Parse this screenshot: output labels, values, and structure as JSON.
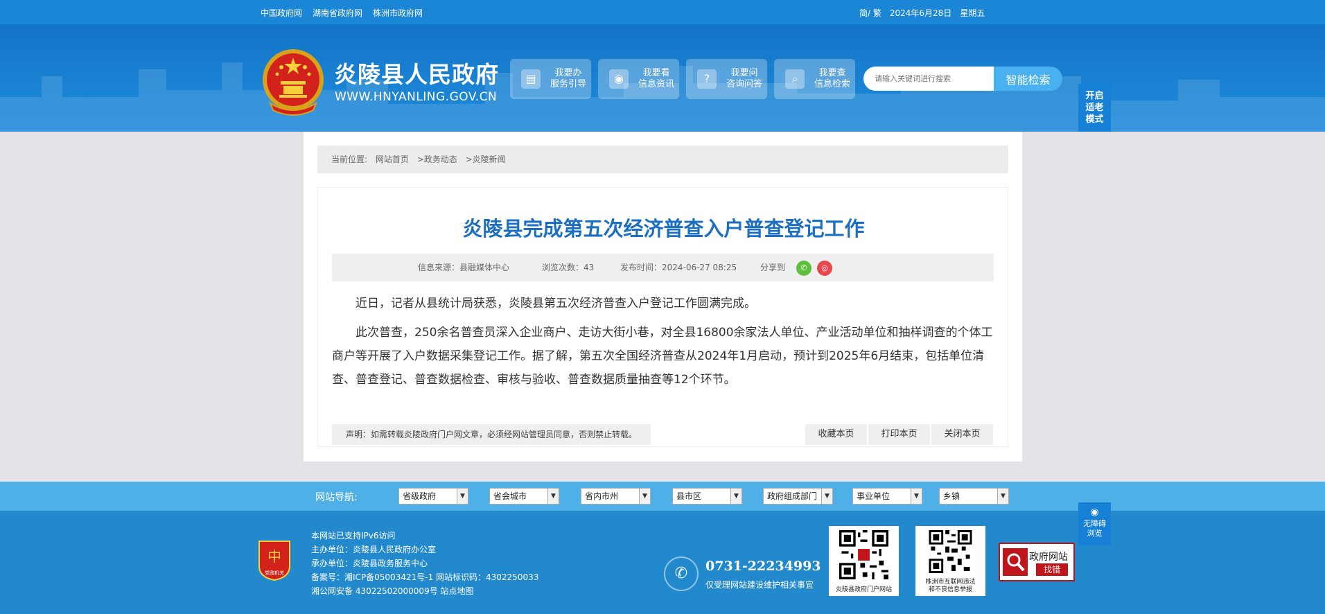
{
  "topbar": {
    "links": [
      "中国政府网",
      "湖南省政府网",
      "株洲市政府网"
    ],
    "lang": "简/ 繁",
    "date": "2024年6月28日",
    "weekday": "星期五"
  },
  "header": {
    "site_name": "炎陵县人民政府",
    "site_url": "WWW.HNYANLING.GOV.CN",
    "buttons": [
      {
        "line1": "我要办",
        "line2": "服务引导",
        "icon": "document-icon"
      },
      {
        "line1": "我要看",
        "line2": "信息资讯",
        "icon": "eye-icon"
      },
      {
        "line1": "我要问",
        "line2": "咨询问答",
        "icon": "question-icon"
      },
      {
        "line1": "我要查",
        "line2": "信息检索",
        "icon": "search-icon"
      }
    ],
    "search_placeholder": "请输入关键词进行搜索",
    "search_button": "智能检索",
    "elder_mode": "开启适老模式"
  },
  "breadcrumb": {
    "label": "当前位置:",
    "items": [
      "网站首页",
      ">政务动态",
      ">炎陵新闻"
    ]
  },
  "article": {
    "title": "炎陵县完成第五次经济普查入户普查登记工作",
    "source": "信息来源：县融媒体中心",
    "views": "浏览次数：43",
    "published": "发布时间：2024-06-27 08:25",
    "share_label": "分享到",
    "paragraphs": [
      "近日，记者从县统计局获悉，炎陵县第五次经济普查入户登记工作圆满完成。",
      "此次普查，250余名普查员深入企业商户、走访大街小巷，对全县16800余家法人单位、产业活动单位和抽样调查的个体工商户等开展了入户数据采集登记工作。据了解，第五次全国经济普查从2024年1月启动，预计到2025年6月结束，包括单位清查、普查登记、普查数据检查、审核与验收、普查数据质量抽查等12个环节。"
    ],
    "notice": "声明：如需转载炎陵政府门户网文章，必须经网站管理员同意，否则禁止转载。",
    "actions": [
      "收藏本页",
      "打印本页",
      "关闭本页"
    ]
  },
  "site_nav": {
    "label": "网站导航:",
    "selects": [
      "省级政府",
      "省会城市",
      "省内市州",
      "县市区",
      "政府组成部门",
      "事业单位",
      "乡镇"
    ]
  },
  "footer": {
    "badge_text": "党政机关",
    "lines": [
      "本网站已支持IPv6访问",
      "主办单位：炎陵县人民政府办公室",
      "承办单位：炎陵县政务服务中心",
      "备案号：湘ICP备05003421号-1 网站标识码：4302250033",
      "湘公网安备 43022502000009号 站点地图"
    ],
    "phone": "0731-22234993",
    "phone_note": "仅受理网站建设维护相关事宜",
    "qr1_caption": "炎陵县政府门户网站",
    "qr2_caption_1": "株洲市互联网违法",
    "qr2_caption_2": "和不良信息举报",
    "report_1": "政府网站",
    "report_2": "找错",
    "accessibility": "无障碍浏览"
  },
  "colors": {
    "brand_blue": "#1c86d6",
    "title_blue": "#1c6fc0",
    "footer_blue": "#2389cd",
    "nav_blue": "#4fb0e8"
  }
}
